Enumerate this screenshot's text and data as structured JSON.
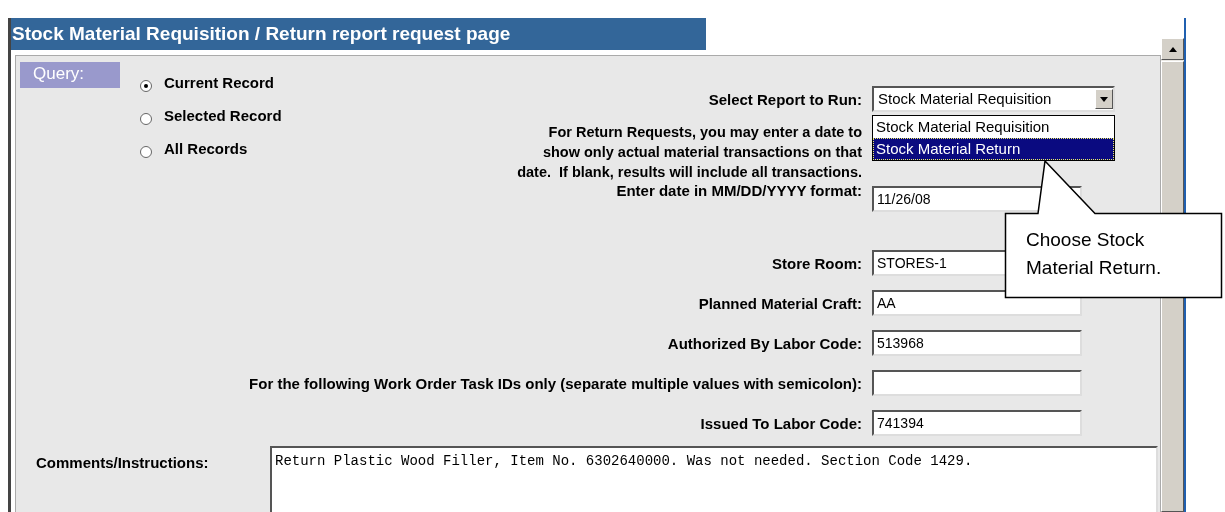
{
  "title": "Stock Material Requisition / Return report request page",
  "query": {
    "label": "Query:",
    "options": [
      {
        "label": "Current Record",
        "selected": true
      },
      {
        "label": "Selected Record",
        "selected": false
      },
      {
        "label": "All Records",
        "selected": false
      }
    ]
  },
  "report": {
    "label": "Select Report to Run:",
    "value": "Stock Material Requisition",
    "expanded": true,
    "options": [
      {
        "label": "Stock Material Requisition",
        "highlighted": false
      },
      {
        "label": "Stock Material Return",
        "highlighted": true
      }
    ]
  },
  "note": [
    "For Return Requests, you may enter a date to",
    "show only actual material transactions on that",
    "date.  If blank, results will include all transactions."
  ],
  "date_field": {
    "label": "Enter date in MM/DD/YYYY format:",
    "value": "11/26/08"
  },
  "fields": [
    {
      "label": "Store Room:",
      "value": "STORES-1"
    },
    {
      "label": "Planned Material Craft:",
      "value": "AA"
    },
    {
      "label": "Authorized By Labor Code:",
      "value": "513968"
    },
    {
      "label": "For the following Work Order Task IDs only (separate multiple values with semicolon):"
    },
    {
      "label": "Issued To Labor Code:",
      "value": "741394"
    }
  ],
  "comments": {
    "label": "Comments/Instructions:",
    "value": "Return Plastic Wood Filler, Item No. 6302640000. Was not needed. Section Code 1429."
  },
  "callout": "Choose Stock Material Return."
}
